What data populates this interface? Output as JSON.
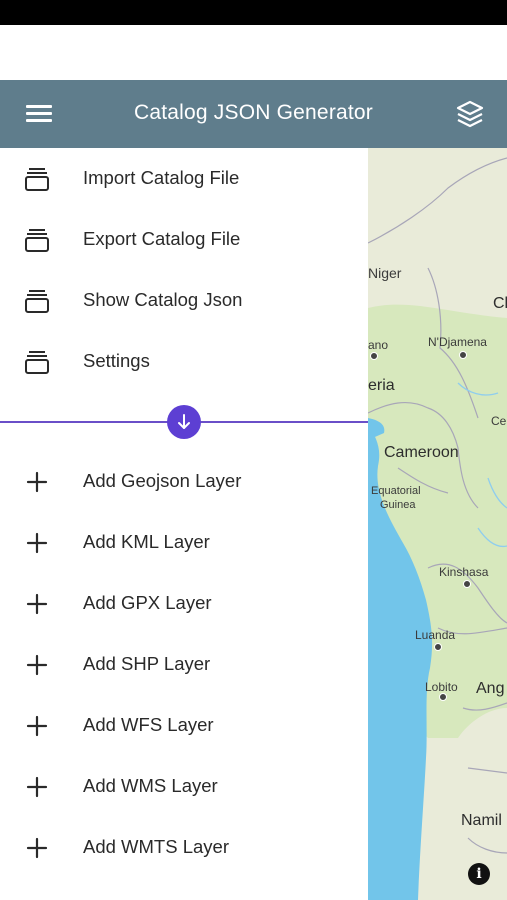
{
  "app_bar": {
    "title": "Catalog JSON Generator",
    "menu_icon": "hamburger-menu-icon",
    "layers_icon": "layers-icon"
  },
  "drawer": {
    "file_items": [
      {
        "label": "Import Catalog File",
        "icon": "stack-icon"
      },
      {
        "label": "Export Catalog File",
        "icon": "stack-icon"
      },
      {
        "label": "Show Catalog Json",
        "icon": "stack-icon"
      },
      {
        "label": "Settings",
        "icon": "stack-icon"
      }
    ],
    "toggle_icon": "arrow-down-icon",
    "layer_items": [
      {
        "label": "Add Geojson Layer",
        "icon": "plus-icon"
      },
      {
        "label": "Add KML Layer",
        "icon": "plus-icon"
      },
      {
        "label": "Add GPX Layer",
        "icon": "plus-icon"
      },
      {
        "label": "Add SHP Layer",
        "icon": "plus-icon"
      },
      {
        "label": "Add WFS Layer",
        "icon": "plus-icon"
      },
      {
        "label": "Add WMS Layer",
        "icon": "plus-icon"
      },
      {
        "label": "Add WMTS Layer",
        "icon": "plus-icon"
      }
    ]
  },
  "map": {
    "labels": {
      "niger": "Niger",
      "chad": "Cl",
      "ndjamena": "N'Djamena",
      "abuja_partial": "ano",
      "nigeria_partial": "eria",
      "central_partial": "Ce",
      "cameroon": "Cameroon",
      "eq_guinea_1": "Equatorial",
      "eq_guinea_2": "Guinea",
      "kinshasa": "Kinshasa",
      "luanda": "Luanda",
      "lobito": "Lobito",
      "angola_partial": "Ang",
      "namibia_partial": "Namil"
    },
    "info_label": "i"
  },
  "colors": {
    "app_bar": "#5f7d8c",
    "accent": "#5d3fd3",
    "ocean": "#71c4e8",
    "land": "#e9ebd9",
    "green": "#d9e9bf"
  }
}
